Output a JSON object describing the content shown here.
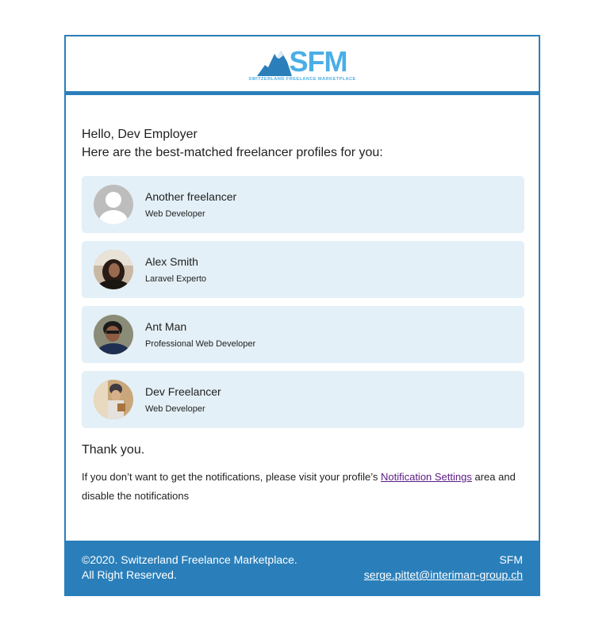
{
  "header": {
    "logo_text": "SFM",
    "logo_subtitle": "SWITZERLAND FREELANCE MARKETPLACE"
  },
  "greeting": "Hello, Dev Employer",
  "intro": "Here are the best-matched freelancer profiles for you:",
  "freelancers": [
    {
      "name": "Another freelancer",
      "title": "Web Developer",
      "avatar": "default-avatar-icon"
    },
    {
      "name": "Alex Smith",
      "title": "Laravel Experto",
      "avatar": "photo-avatar"
    },
    {
      "name": "Ant Man",
      "title": "Professional Web Developer",
      "avatar": "photo-avatar"
    },
    {
      "name": "Dev Freelancer",
      "title": "Web Developer",
      "avatar": "photo-avatar"
    }
  ],
  "thanks": "Thank you.",
  "note": {
    "before": "If you don’t want to get the notifications, please visit your profile’s ",
    "link": "Notification Settings",
    "after": " area and disable the notifications"
  },
  "footer": {
    "copyright": "©2020. Switzerland Freelance Marketplace.",
    "rights": "All Right Reserved.",
    "brand": "SFM",
    "email": "serge.pittet@interiman-group.ch"
  },
  "colors": {
    "brand_blue": "#2a7fba",
    "logo_blue": "#4aaee6",
    "card_bg": "#e4f0f7",
    "link_purple": "#5a1a86"
  }
}
